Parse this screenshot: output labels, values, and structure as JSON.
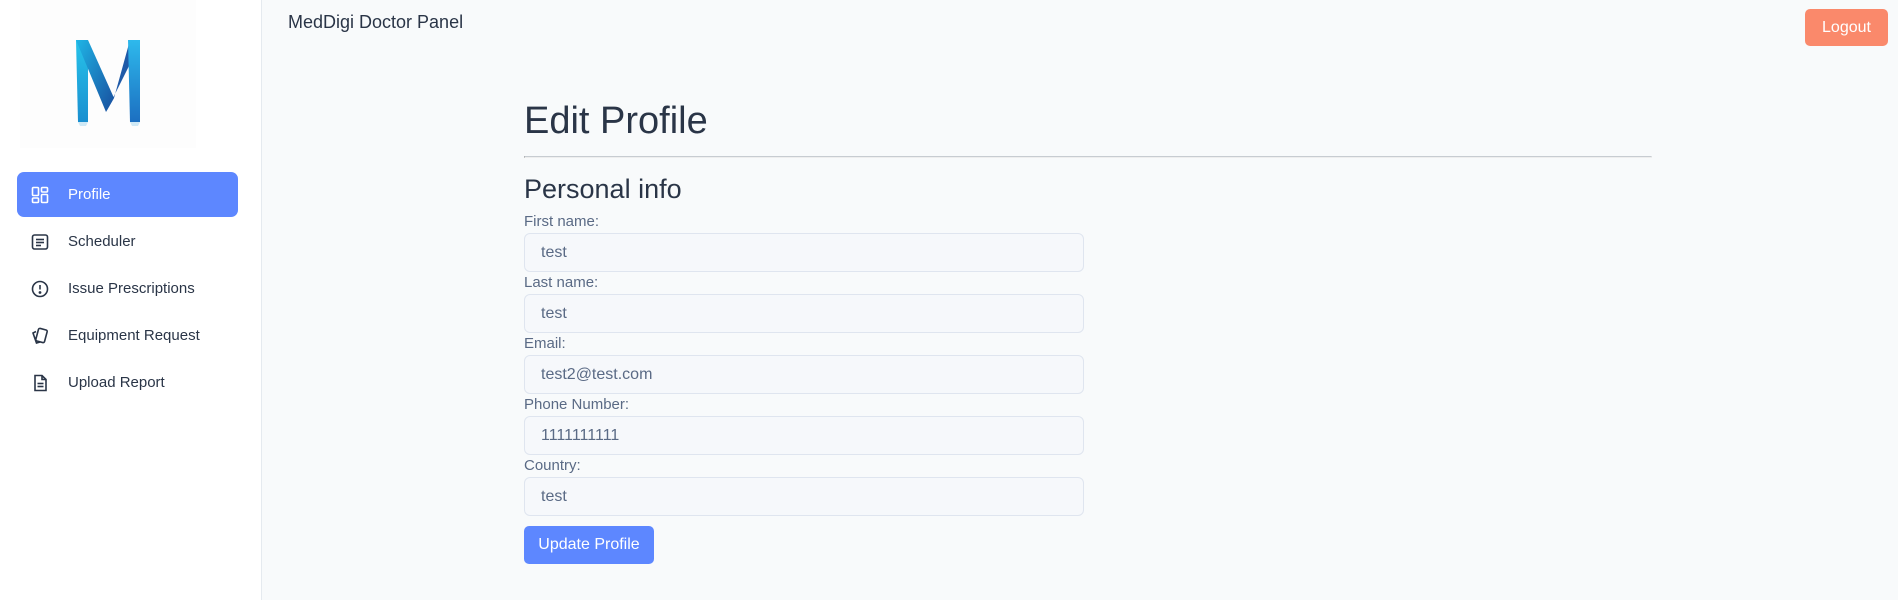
{
  "sidebar": {
    "logo": {
      "icon": "meddigi-m-logo-icon",
      "color_primary": "#1aa3d9",
      "color_secondary": "#1f5aa8"
    },
    "items": [
      {
        "label": "Profile",
        "icon": "dashboard-grid-icon",
        "active": true
      },
      {
        "label": "Scheduler",
        "icon": "list-details-icon",
        "active": false
      },
      {
        "label": "Issue Prescriptions",
        "icon": "alert-circle-icon",
        "active": false
      },
      {
        "label": "Equipment Request",
        "icon": "cards-icon",
        "active": false
      },
      {
        "label": "Upload Report",
        "icon": "file-text-icon",
        "active": false
      }
    ]
  },
  "header": {
    "title": "MedDigi Doctor Panel",
    "logout_label": "Logout"
  },
  "main": {
    "page_title": "Edit Profile",
    "section_title": "Personal info",
    "fields": [
      {
        "label": "First name:",
        "value": "test"
      },
      {
        "label": "Last name:",
        "value": "test"
      },
      {
        "label": "Email:",
        "value": "test2@test.com"
      },
      {
        "label": "Phone Number:",
        "value": "1111111111"
      },
      {
        "label": "Country:",
        "value": "test"
      }
    ],
    "update_label": "Update Profile"
  },
  "colors": {
    "accent": "#5d87ff",
    "logout": "#fa896b",
    "text": "#2a3547"
  }
}
